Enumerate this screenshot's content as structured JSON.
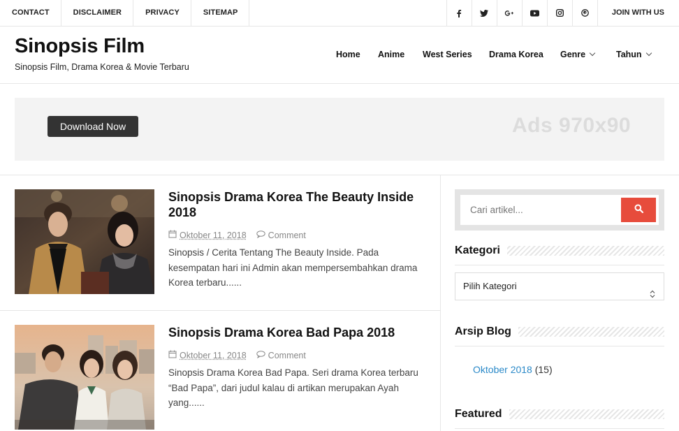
{
  "topbar": {
    "links": [
      "CONTACT",
      "DISCLAIMER",
      "PRIVACY",
      "SITEMAP"
    ],
    "social_icons": [
      "facebook-icon",
      "twitter-icon",
      "google-plus-icon",
      "youtube-icon",
      "instagram-icon",
      "pinterest-icon"
    ],
    "join_label": "JOIN WITH US"
  },
  "header": {
    "title": "Sinopsis Film",
    "description": "Sinopsis Film, Drama Korea & Movie Terbaru"
  },
  "nav": {
    "home": "Home",
    "anime": "Anime",
    "west": "West Series",
    "drama": "Drama Korea",
    "genre": "Genre",
    "tahun": "Tahun"
  },
  "ad": {
    "button_label": "Download Now",
    "text": "Ads 970x90"
  },
  "posts": [
    {
      "title": "Sinopsis Drama Korea The Beauty Inside 2018",
      "date": "Oktober 11, 2018",
      "comment": "Comment",
      "excerpt": "Sinopsis / Cerita Tentang The Beauty Inside. Pada kesempatan hari ini Admin akan mempersembahkan drama Korea terbaru......"
    },
    {
      "title": "Sinopsis Drama Korea Bad Papa 2018",
      "date": "Oktober 11, 2018",
      "comment": "Comment",
      "excerpt": "Sinopsis Drama Korea Bad Papa. Seri drama Korea terbaru “Bad Papa”, dari judul kalau di artikan merupakan Ayah yang......"
    }
  ],
  "sidebar": {
    "search_placeholder": "Cari artikel...",
    "kategori_title": "Kategori",
    "kategori_select": "Pilih Kategori",
    "arsip_title": "Arsip Blog",
    "arsip_month": "Oktober 2018",
    "arsip_count": "(15)",
    "featured_title": "Featured"
  },
  "colors": {
    "accent": "#e74c3c",
    "link": "#2a89c8"
  }
}
